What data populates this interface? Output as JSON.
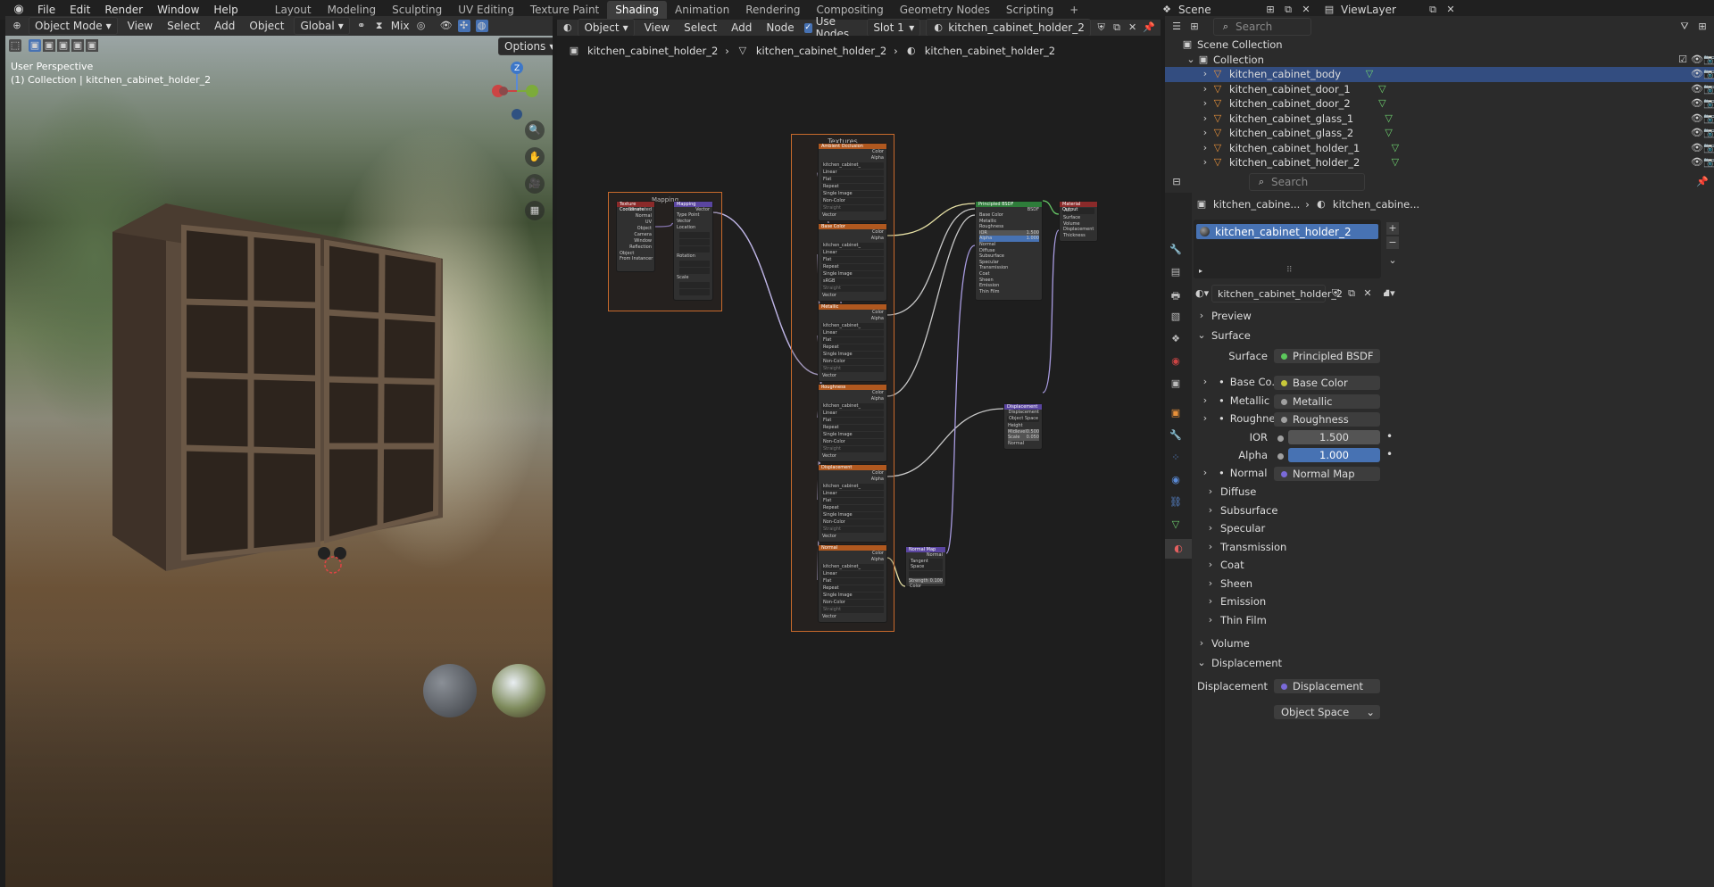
{
  "app_menu": [
    "File",
    "Edit",
    "Render",
    "Window",
    "Help"
  ],
  "workspaces": [
    "Layout",
    "Modeling",
    "Sculpting",
    "UV Editing",
    "Texture Paint",
    "Shading",
    "Animation",
    "Rendering",
    "Compositing",
    "Geometry Nodes",
    "Scripting",
    "+"
  ],
  "active_workspace": "Shading",
  "scene": {
    "label": "Scene",
    "view_layer": "ViewLayer"
  },
  "viewport": {
    "mode": "Object Mode",
    "menus": [
      "View",
      "Select",
      "Add",
      "Object"
    ],
    "orientation": "Global",
    "shading_mix": "Mix",
    "options": "Options",
    "perspective": "User Perspective",
    "collection_line": "(1) Collection | kitchen_cabinet_holder_2",
    "gizmo_z": "Z"
  },
  "node_editor": {
    "type": "Object",
    "menus": [
      "View",
      "Select",
      "Add",
      "Node"
    ],
    "use_nodes_label": "Use Nodes",
    "slot": "Slot 1",
    "material": "kitchen_cabinet_holder_2",
    "breadcrumbs": [
      "kitchen_cabinet_holder_2",
      "kitchen_cabinet_holder_2",
      "kitchen_cabinet_holder_2"
    ],
    "frame_textures": "Textures",
    "frame_mapping": "Mapping",
    "texcoord_title": "Texture Coordinate",
    "texcoord_outputs": [
      "Generated",
      "Normal",
      "UV",
      "Object",
      "Camera",
      "Window",
      "Reflection"
    ],
    "texcoord_object": "Object",
    "texcoord_from_instancer": "From Instancer",
    "mapping_title": "Mapping",
    "mapping_rows": [
      "Vector",
      "Type",
      "Point",
      "Vector",
      "Location",
      "Rotation",
      "Scale"
    ],
    "tex_nodes": [
      {
        "title": "Ambient Occlusion",
        "colorspace": "Non-Color"
      },
      {
        "title": "Base Color",
        "colorspace": "sRGB"
      },
      {
        "title": "Metallic",
        "colorspace": "Non-Color"
      },
      {
        "title": "Roughness",
        "colorspace": "Non-Color"
      },
      {
        "title": "Displacement",
        "colorspace": "Non-Color"
      },
      {
        "title": "Normal",
        "colorspace": "Non-Color"
      }
    ],
    "tex_common": {
      "image": "kitchen_cabinet_",
      "interp": "Linear",
      "proj": "Flat",
      "ext": "Repeat",
      "src": "Single Image",
      "alpha": "Straight",
      "vector": "Vector",
      "color": "Color",
      "alpha_out": "Alpha"
    },
    "bsdf_title": "Principled BSDF",
    "bsdf_out": "BSDF",
    "bsdf_inputs": [
      "Base Color",
      "Metallic",
      "Roughness",
      "IOR",
      "Alpha",
      "Normal",
      "Diffuse",
      "Subsurface",
      "Specular",
      "Transmission",
      "Coat",
      "Sheen",
      "Emission",
      "Thin Film"
    ],
    "bsdf_ior": "1.500",
    "bsdf_alpha": "1.000",
    "output_title": "Material Output",
    "output_target": "All",
    "output_inputs": [
      "Surface",
      "Volume",
      "Displacement",
      "Thickness"
    ],
    "disp_title": "Displacement",
    "disp_out": "Displacement",
    "disp_space": "Object Space",
    "disp_rows": [
      "Height",
      "Midlevel",
      "Scale",
      "Normal"
    ],
    "disp_midlevel": "0.500",
    "disp_scale": "0.050",
    "normal_title": "Normal Map",
    "normal_out": "Normal",
    "normal_space": "Tangent Space",
    "normal_strength_label": "Strength",
    "normal_strength": "0.100",
    "normal_color": "Color"
  },
  "outliner": {
    "search_placeholder": "Search",
    "scene_collection": "Scene Collection",
    "collection": "Collection",
    "items": [
      "kitchen_cabinet_body",
      "kitchen_cabinet_door_1",
      "kitchen_cabinet_door_2",
      "kitchen_cabinet_glass_1",
      "kitchen_cabinet_glass_2",
      "kitchen_cabinet_holder_1",
      "kitchen_cabinet_holder_2"
    ],
    "selected_index": 0
  },
  "properties": {
    "search_placeholder": "Search",
    "breadcrumb_obj": "kitchen_cabine...",
    "breadcrumb_mat": "kitchen_cabine...",
    "slot_name": "kitchen_cabinet_holder_2",
    "material_name": "kitchen_cabinet_holder_2",
    "sections": {
      "preview": "Preview",
      "surface": "Surface",
      "volume": "Volume",
      "displacement": "Displacement"
    },
    "surface_label": "Surface",
    "surface_value": "Principled BSDF",
    "base_color_label": "Base Co...",
    "base_color_value": "Base Color",
    "metallic_label": "Metallic",
    "metallic_value": "Metallic",
    "roughness_label": "Roughne...",
    "roughness_value": "Roughness",
    "ior_label": "IOR",
    "ior_value": "1.500",
    "alpha_label": "Alpha",
    "alpha_value": "1.000",
    "normal_label": "Normal",
    "normal_value": "Normal Map",
    "subpanels": [
      "Diffuse",
      "Subsurface",
      "Specular",
      "Transmission",
      "Coat",
      "Sheen",
      "Emission",
      "Thin Film"
    ],
    "disp_label": "Displacement",
    "disp_value": "Displacement",
    "disp_method": "Object Space"
  },
  "colors": {
    "accent": "#4772b3",
    "selected_row": "#334d80",
    "frame": "#c86a2c",
    "texture_header": "#b0581f",
    "shader_header": "#2e7d3a",
    "output_header": "#8a2a2a",
    "vector_header": "#5a45a0"
  }
}
